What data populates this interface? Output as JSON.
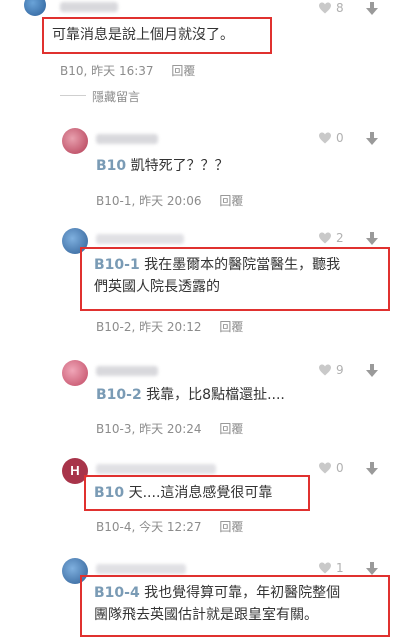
{
  "comments": [
    {
      "id": "c1",
      "avatar_color": "#3b82c4",
      "text": "可靠消息是說上個月就沒了。",
      "floor": "B10",
      "time": "昨天 16:37",
      "reply": "回覆",
      "likes": "8"
    },
    {
      "id": "c2",
      "avatar_color": "#c0485a",
      "floor_tag": "B10",
      "text": "凱特死了？？？",
      "floor": "B10-1",
      "time": "昨天 20:06",
      "reply": "回覆",
      "likes": "0"
    },
    {
      "id": "c3",
      "avatar_color": "#3b6fa8",
      "floor_tag": "B10-1",
      "text_line1": "我在墨爾本的醫院當醫生，聽我",
      "text_line2": "們英國人院長透露的",
      "floor": "B10-2",
      "time": "昨天 20:12",
      "reply": "回覆",
      "likes": "2"
    },
    {
      "id": "c4",
      "avatar_color": "#c8506a",
      "floor_tag": "B10-2",
      "text": "我靠，比8點檔還扯....",
      "floor": "B10-3",
      "time": "昨天 20:24",
      "reply": "回覆",
      "likes": "9"
    },
    {
      "id": "c5",
      "avatar_color": "#a8344a",
      "avatar_letter": "H",
      "floor_tag": "B10",
      "text": "天....這消息感覺很可靠",
      "floor": "B10-4",
      "time": "今天 12:27",
      "reply": "回覆",
      "likes": "0"
    },
    {
      "id": "c6",
      "avatar_color": "#3b6fa8",
      "floor_tag": "B10-4",
      "text_line1": "我也覺得算可靠，年初醫院整個",
      "text_line2": "團隊飛去英國估計就是跟皇室有關。",
      "likes": "1"
    }
  ],
  "hidden_label": "隱藏留言",
  "colors": {
    "red_box": "#e0312f",
    "floor_tag": "#7a9bb5"
  }
}
